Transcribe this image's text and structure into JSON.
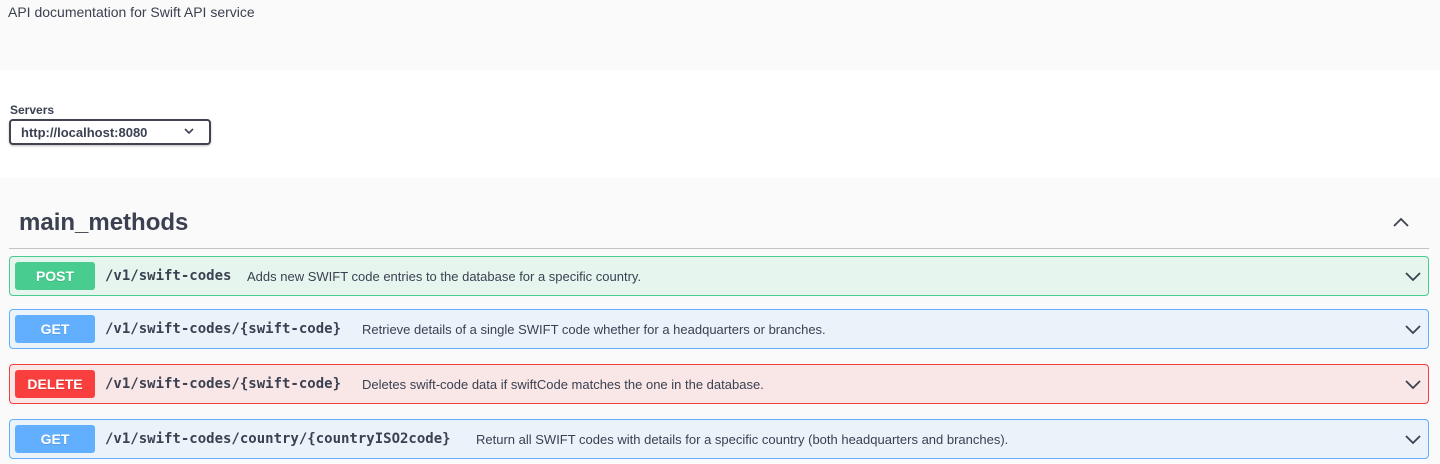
{
  "info": {
    "description": "API documentation for Swift API service"
  },
  "servers": {
    "label": "Servers",
    "selected": "http://localhost:8080",
    "icon": "chevron-down-icon"
  },
  "tag": {
    "name": "main_methods",
    "toggle_icon": "chevron-up-icon"
  },
  "operations": [
    {
      "method": "POST",
      "path": "/v1/swift-codes",
      "summary": "Adds new SWIFT code entries to the database for a specific country.",
      "color": "#49cc90"
    },
    {
      "method": "GET",
      "path": "/v1/swift-codes/{swift-code}",
      "summary": "Retrieve details of a single SWIFT code whether for a headquarters or branches.",
      "color": "#61affe"
    },
    {
      "method": "DELETE",
      "path": "/v1/swift-codes/{swift-code}",
      "summary": "Deletes swift-code data if swiftCode matches the one in the database.",
      "color": "#f93e3e"
    },
    {
      "method": "GET",
      "path": "/v1/swift-codes/country/{countryISO2code}",
      "summary": "Return all SWIFT codes with details for a specific country (both headquarters and branches).",
      "color": "#61affe"
    }
  ]
}
